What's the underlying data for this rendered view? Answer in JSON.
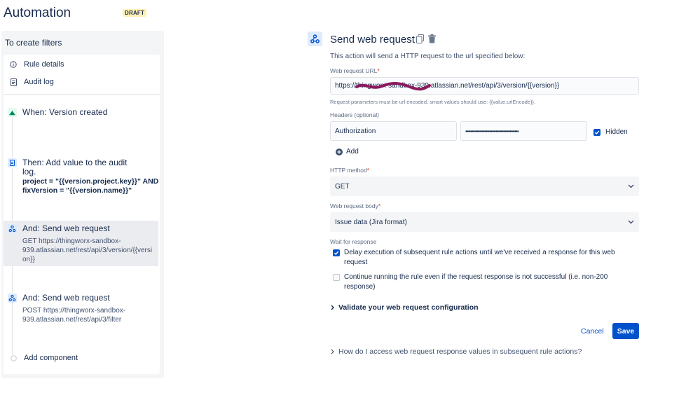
{
  "header": {
    "title": "Automation",
    "badge": "DRAFT"
  },
  "sidebar": {
    "rule_name": "To create filters",
    "menu": [
      {
        "label": "Rule details",
        "icon": "info-icon"
      },
      {
        "label": "Audit log",
        "icon": "document-icon"
      }
    ],
    "components": [
      {
        "title": "When: Version created",
        "icon": "version-icon"
      },
      {
        "title_line1": "Then: Add value to the audit",
        "title_line2": "log.",
        "bold_line1": "project = \"{{version.project.key}}\" AND",
        "bold_line2": "fixVersion = \"{{version.name}}\"",
        "icon": "audit-icon"
      },
      {
        "title": "And: Send web request",
        "desc_line1": "GET https://thingworx-sandbox-",
        "desc_line2": "939.atlassian.net/rest/api/3/version/{{versi",
        "desc_line3": "on}}",
        "icon": "webhook-icon"
      },
      {
        "title": "And: Send web request",
        "desc_line1": "POST https://thingworx-sandbox-",
        "desc_line2": "939.atlassian.net/rest/api/3/filter",
        "icon": "webhook-icon"
      }
    ],
    "add_component": "Add component"
  },
  "form": {
    "title": "Send web request",
    "description": "This action will send a HTTP request to the url specified below:",
    "url_label": "Web request URL",
    "url_value": "https://thingworx-sandbox-939.atlassian.net/rest/api/3/version/{{version}}",
    "url_helper": "Request parameters must be url encoded, smart values should use: {{value.urlEncode}}.",
    "headers_label": "Headers (optional)",
    "header_name": "Authorization",
    "header_value": "••••••••••••••••••••••••••••••••••••••••••",
    "hidden_label": "Hidden",
    "hidden_checked": true,
    "add_label": "Add",
    "method_label": "HTTP method",
    "method_value": "GET",
    "body_label": "Web request body",
    "body_value": "Issue data (Jira format)",
    "wait_label": "Wait for response",
    "wait_option1_line1": "Delay execution of subsequent rule actions until we've received a response for this web",
    "wait_option1_line2": "request",
    "wait_option1_checked": true,
    "wait_option2_line1": "Continue running the rule even if the request response is not successful (i.e. non-200",
    "wait_option2_line2": "response)",
    "wait_option2_checked": false,
    "validate_label": "Validate your web request configuration",
    "cancel_label": "Cancel",
    "save_label": "Save",
    "faq_label": "How do I access web request response values in subsequent rule actions?"
  },
  "colors": {
    "primary": "#0052cc",
    "text": "#172b4d",
    "badge_bg": "#fff0b3",
    "redaction": "#8b1a5c"
  }
}
